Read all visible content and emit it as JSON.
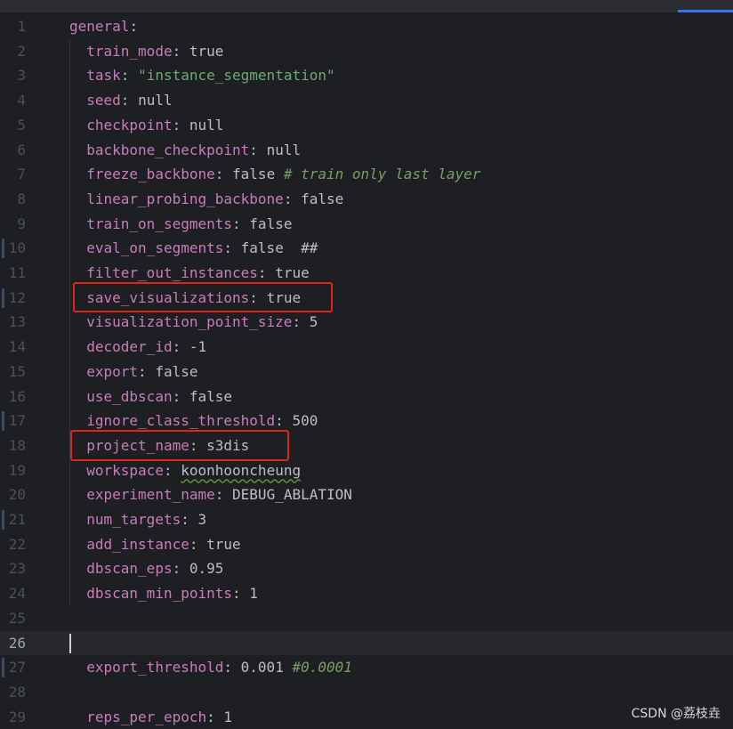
{
  "lines": [
    {
      "n": "1",
      "indent": 0,
      "key": "general",
      "colon": ":",
      "value": "",
      "type": "plain",
      "comment": ""
    },
    {
      "n": "2",
      "indent": 1,
      "key": "train_mode",
      "colon": ":",
      "value": "true",
      "type": "plain",
      "comment": ""
    },
    {
      "n": "3",
      "indent": 1,
      "key": "task",
      "colon": ":",
      "value": "\"instance_segmentation\"",
      "type": "string",
      "comment": ""
    },
    {
      "n": "4",
      "indent": 1,
      "key": "seed",
      "colon": ":",
      "value": "null",
      "type": "plain",
      "comment": ""
    },
    {
      "n": "5",
      "indent": 1,
      "key": "checkpoint",
      "colon": ":",
      "value": "null",
      "type": "plain",
      "comment": ""
    },
    {
      "n": "6",
      "indent": 1,
      "key": "backbone_checkpoint",
      "colon": ":",
      "value": "null",
      "type": "plain",
      "comment": ""
    },
    {
      "n": "7",
      "indent": 1,
      "key": "freeze_backbone",
      "colon": ":",
      "value": "false",
      "type": "plain",
      "comment": "# train only last layer"
    },
    {
      "n": "8",
      "indent": 1,
      "key": "linear_probing_backbone",
      "colon": ":",
      "value": "false",
      "type": "plain",
      "comment": ""
    },
    {
      "n": "9",
      "indent": 1,
      "key": "train_on_segments",
      "colon": ":",
      "value": "false",
      "type": "plain",
      "comment": ""
    },
    {
      "n": "10",
      "indent": 1,
      "key": "eval_on_segments",
      "colon": ":",
      "value": "false  ##",
      "type": "plain",
      "comment": ""
    },
    {
      "n": "11",
      "indent": 1,
      "key": "filter_out_instances",
      "colon": ":",
      "value": "true",
      "type": "plain",
      "comment": ""
    },
    {
      "n": "12",
      "indent": 1,
      "key": "save_visualizations",
      "colon": ":",
      "value": "true",
      "type": "plain",
      "comment": ""
    },
    {
      "n": "13",
      "indent": 1,
      "key": "visualization_point_size",
      "colon": ":",
      "value": "5",
      "type": "plain",
      "comment": ""
    },
    {
      "n": "14",
      "indent": 1,
      "key": "decoder_id",
      "colon": ":",
      "value": "-1",
      "type": "plain",
      "comment": ""
    },
    {
      "n": "15",
      "indent": 1,
      "key": "export",
      "colon": ":",
      "value": "false",
      "type": "plain",
      "comment": ""
    },
    {
      "n": "16",
      "indent": 1,
      "key": "use_dbscan",
      "colon": ":",
      "value": "false",
      "type": "plain",
      "comment": ""
    },
    {
      "n": "17",
      "indent": 1,
      "key": "ignore_class_threshold",
      "colon": ":",
      "value": "500",
      "type": "plain",
      "comment": ""
    },
    {
      "n": "18",
      "indent": 1,
      "key": "project_name",
      "colon": ":",
      "value": "s3dis",
      "type": "plain",
      "comment": ""
    },
    {
      "n": "19",
      "indent": 1,
      "key": "workspace",
      "colon": ":",
      "value": "koonhooncheung",
      "type": "squiggle",
      "comment": ""
    },
    {
      "n": "20",
      "indent": 1,
      "key": "experiment_name",
      "colon": ":",
      "value": "DEBUG_ABLATION",
      "type": "plain",
      "comment": ""
    },
    {
      "n": "21",
      "indent": 1,
      "key": "num_targets",
      "colon": ":",
      "value": "3",
      "type": "plain",
      "comment": ""
    },
    {
      "n": "22",
      "indent": 1,
      "key": "add_instance",
      "colon": ":",
      "value": "true",
      "type": "plain",
      "comment": ""
    },
    {
      "n": "23",
      "indent": 1,
      "key": "dbscan_eps",
      "colon": ":",
      "value": "0.95",
      "type": "plain",
      "comment": ""
    },
    {
      "n": "24",
      "indent": 1,
      "key": "dbscan_min_points",
      "colon": ":",
      "value": "1",
      "type": "plain",
      "comment": ""
    },
    {
      "n": "25",
      "indent": 0,
      "key": "",
      "colon": "",
      "value": "",
      "type": "plain",
      "comment": ""
    },
    {
      "n": "26",
      "indent": 0,
      "key": "",
      "colon": "",
      "value": "",
      "type": "plain",
      "comment": "",
      "current": true
    },
    {
      "n": "27",
      "indent": 1,
      "key": "export_threshold",
      "colon": ":",
      "value": "0.001",
      "type": "plain",
      "comment": "#0.0001"
    },
    {
      "n": "28",
      "indent": 0,
      "key": "",
      "colon": "",
      "value": "",
      "type": "plain",
      "comment": ""
    },
    {
      "n": "29",
      "indent": 1,
      "key": "reps_per_epoch",
      "colon": ":",
      "value": "1",
      "type": "plain",
      "comment": ""
    }
  ],
  "highlighted_lines": [
    "12",
    "18"
  ],
  "watermark": "CSDN @荔枝垚",
  "colors": {
    "background": "#1e1f22",
    "key": "#c77dbb",
    "string": "#6aab73",
    "comment": "#7a9e65",
    "highlight_box": "#e0241b"
  }
}
